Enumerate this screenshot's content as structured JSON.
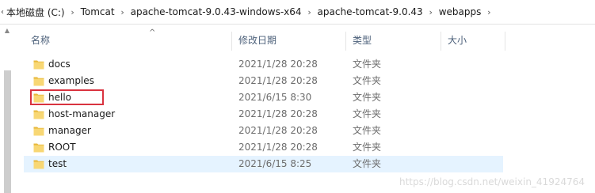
{
  "breadcrumb": {
    "items": [
      "本地磁盘 (C:)",
      "Tomcat",
      "apache-tomcat-9.0.43-windows-x64",
      "apache-tomcat-9.0.43",
      "webapps"
    ],
    "separator": "›"
  },
  "columns": {
    "name": "名称",
    "date": "修改日期",
    "type": "类型",
    "size": "大小"
  },
  "files": [
    {
      "name": "docs",
      "date": "2021/1/28 20:28",
      "type": "文件夹",
      "selected": false,
      "highlighted": false
    },
    {
      "name": "examples",
      "date": "2021/1/28 20:28",
      "type": "文件夹",
      "selected": false,
      "highlighted": false
    },
    {
      "name": "hello",
      "date": "2021/6/15 8:30",
      "type": "文件夹",
      "selected": false,
      "highlighted": true
    },
    {
      "name": "host-manager",
      "date": "2021/1/28 20:28",
      "type": "文件夹",
      "selected": false,
      "highlighted": false
    },
    {
      "name": "manager",
      "date": "2021/1/28 20:28",
      "type": "文件夹",
      "selected": false,
      "highlighted": false
    },
    {
      "name": "ROOT",
      "date": "2021/1/28 20:28",
      "type": "文件夹",
      "selected": false,
      "highlighted": false
    },
    {
      "name": "test",
      "date": "2021/6/15 8:25",
      "type": "文件夹",
      "selected": true,
      "highlighted": false
    }
  ],
  "watermark": "https://blog.csdn.net/weixin_41924764",
  "colors": {
    "folder": "#f8d774",
    "folder_dark": "#e8b93c",
    "selection": "#e5f3ff",
    "highlight_border": "#d9333f",
    "header_text": "#4c607a"
  },
  "icons": {
    "folder": "folder-icon",
    "sort": "sort-ascending-icon",
    "separator": "chevron-right-icon"
  }
}
